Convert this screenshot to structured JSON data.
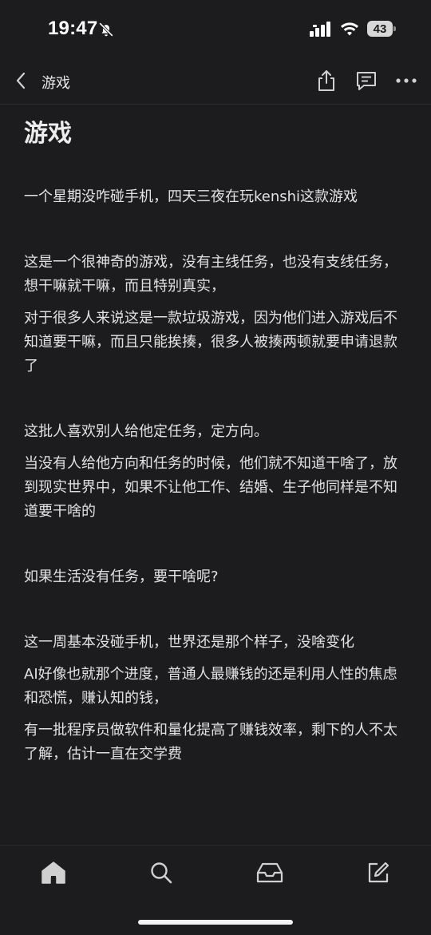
{
  "status_bar": {
    "time": "19:47",
    "battery_level": "43"
  },
  "nav": {
    "title": "游戏"
  },
  "note": {
    "title": "游戏",
    "paragraphs": [
      "一个星期没咋碰手机，四天三夜在玩kenshi这款游戏",
      "这是一个很神奇的游戏，没有主线任务，也没有支线任务，想干嘛就干嘛，而且特别真实，",
      "对于很多人来说这是一款垃圾游戏，因为他们进入游戏后不知道要干嘛，而且只能挨揍，很多人被揍两顿就要申请退款了",
      "这批人喜欢别人给他定任务，定方向。",
      "当没有人给他方向和任务的时候，他们就不知道干啥了，放到现实世界中，如果不让他工作、结婚、生子他同样是不知道要干啥的",
      "如果生活没有任务，要干啥呢?",
      "这一周基本没碰手机，世界还是那个样子，没啥变化",
      "AI好像也就那个进度，普通人最赚钱的还是利用人性的焦虑和恐慌，赚认知的钱，",
      "有一批程序员做软件和量化提高了赚钱效率，剩下的人不太了解，估计一直在交学费"
    ]
  },
  "colors": {
    "background": "#1c1c1e",
    "text": "#e2e2e2",
    "icon": "#d0d0d0"
  }
}
